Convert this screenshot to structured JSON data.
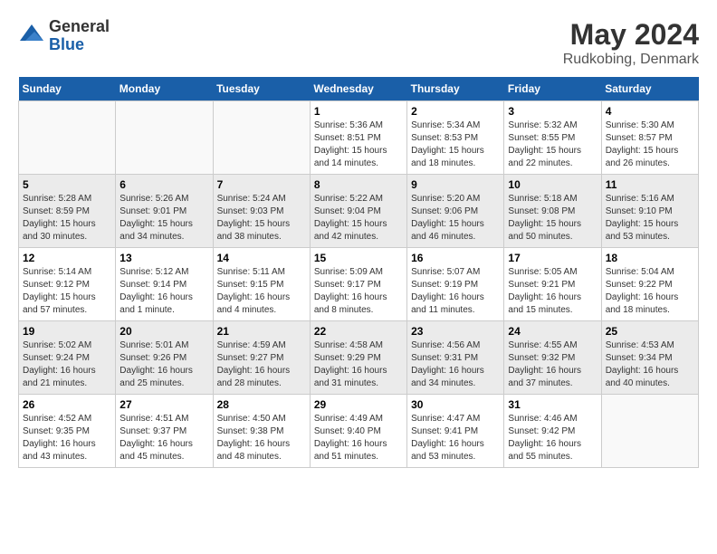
{
  "logo": {
    "general": "General",
    "blue": "Blue"
  },
  "title": {
    "month": "May 2024",
    "location": "Rudkobing, Denmark"
  },
  "days_of_week": [
    "Sunday",
    "Monday",
    "Tuesday",
    "Wednesday",
    "Thursday",
    "Friday",
    "Saturday"
  ],
  "weeks": [
    [
      {
        "day": "",
        "info": ""
      },
      {
        "day": "",
        "info": ""
      },
      {
        "day": "",
        "info": ""
      },
      {
        "day": "1",
        "info": "Sunrise: 5:36 AM\nSunset: 8:51 PM\nDaylight: 15 hours\nand 14 minutes."
      },
      {
        "day": "2",
        "info": "Sunrise: 5:34 AM\nSunset: 8:53 PM\nDaylight: 15 hours\nand 18 minutes."
      },
      {
        "day": "3",
        "info": "Sunrise: 5:32 AM\nSunset: 8:55 PM\nDaylight: 15 hours\nand 22 minutes."
      },
      {
        "day": "4",
        "info": "Sunrise: 5:30 AM\nSunset: 8:57 PM\nDaylight: 15 hours\nand 26 minutes."
      }
    ],
    [
      {
        "day": "5",
        "info": "Sunrise: 5:28 AM\nSunset: 8:59 PM\nDaylight: 15 hours\nand 30 minutes."
      },
      {
        "day": "6",
        "info": "Sunrise: 5:26 AM\nSunset: 9:01 PM\nDaylight: 15 hours\nand 34 minutes."
      },
      {
        "day": "7",
        "info": "Sunrise: 5:24 AM\nSunset: 9:03 PM\nDaylight: 15 hours\nand 38 minutes."
      },
      {
        "day": "8",
        "info": "Sunrise: 5:22 AM\nSunset: 9:04 PM\nDaylight: 15 hours\nand 42 minutes."
      },
      {
        "day": "9",
        "info": "Sunrise: 5:20 AM\nSunset: 9:06 PM\nDaylight: 15 hours\nand 46 minutes."
      },
      {
        "day": "10",
        "info": "Sunrise: 5:18 AM\nSunset: 9:08 PM\nDaylight: 15 hours\nand 50 minutes."
      },
      {
        "day": "11",
        "info": "Sunrise: 5:16 AM\nSunset: 9:10 PM\nDaylight: 15 hours\nand 53 minutes."
      }
    ],
    [
      {
        "day": "12",
        "info": "Sunrise: 5:14 AM\nSunset: 9:12 PM\nDaylight: 15 hours\nand 57 minutes."
      },
      {
        "day": "13",
        "info": "Sunrise: 5:12 AM\nSunset: 9:14 PM\nDaylight: 16 hours\nand 1 minute."
      },
      {
        "day": "14",
        "info": "Sunrise: 5:11 AM\nSunset: 9:15 PM\nDaylight: 16 hours\nand 4 minutes."
      },
      {
        "day": "15",
        "info": "Sunrise: 5:09 AM\nSunset: 9:17 PM\nDaylight: 16 hours\nand 8 minutes."
      },
      {
        "day": "16",
        "info": "Sunrise: 5:07 AM\nSunset: 9:19 PM\nDaylight: 16 hours\nand 11 minutes."
      },
      {
        "day": "17",
        "info": "Sunrise: 5:05 AM\nSunset: 9:21 PM\nDaylight: 16 hours\nand 15 minutes."
      },
      {
        "day": "18",
        "info": "Sunrise: 5:04 AM\nSunset: 9:22 PM\nDaylight: 16 hours\nand 18 minutes."
      }
    ],
    [
      {
        "day": "19",
        "info": "Sunrise: 5:02 AM\nSunset: 9:24 PM\nDaylight: 16 hours\nand 21 minutes."
      },
      {
        "day": "20",
        "info": "Sunrise: 5:01 AM\nSunset: 9:26 PM\nDaylight: 16 hours\nand 25 minutes."
      },
      {
        "day": "21",
        "info": "Sunrise: 4:59 AM\nSunset: 9:27 PM\nDaylight: 16 hours\nand 28 minutes."
      },
      {
        "day": "22",
        "info": "Sunrise: 4:58 AM\nSunset: 9:29 PM\nDaylight: 16 hours\nand 31 minutes."
      },
      {
        "day": "23",
        "info": "Sunrise: 4:56 AM\nSunset: 9:31 PM\nDaylight: 16 hours\nand 34 minutes."
      },
      {
        "day": "24",
        "info": "Sunrise: 4:55 AM\nSunset: 9:32 PM\nDaylight: 16 hours\nand 37 minutes."
      },
      {
        "day": "25",
        "info": "Sunrise: 4:53 AM\nSunset: 9:34 PM\nDaylight: 16 hours\nand 40 minutes."
      }
    ],
    [
      {
        "day": "26",
        "info": "Sunrise: 4:52 AM\nSunset: 9:35 PM\nDaylight: 16 hours\nand 43 minutes."
      },
      {
        "day": "27",
        "info": "Sunrise: 4:51 AM\nSunset: 9:37 PM\nDaylight: 16 hours\nand 45 minutes."
      },
      {
        "day": "28",
        "info": "Sunrise: 4:50 AM\nSunset: 9:38 PM\nDaylight: 16 hours\nand 48 minutes."
      },
      {
        "day": "29",
        "info": "Sunrise: 4:49 AM\nSunset: 9:40 PM\nDaylight: 16 hours\nand 51 minutes."
      },
      {
        "day": "30",
        "info": "Sunrise: 4:47 AM\nSunset: 9:41 PM\nDaylight: 16 hours\nand 53 minutes."
      },
      {
        "day": "31",
        "info": "Sunrise: 4:46 AM\nSunset: 9:42 PM\nDaylight: 16 hours\nand 55 minutes."
      },
      {
        "day": "",
        "info": ""
      }
    ]
  ]
}
